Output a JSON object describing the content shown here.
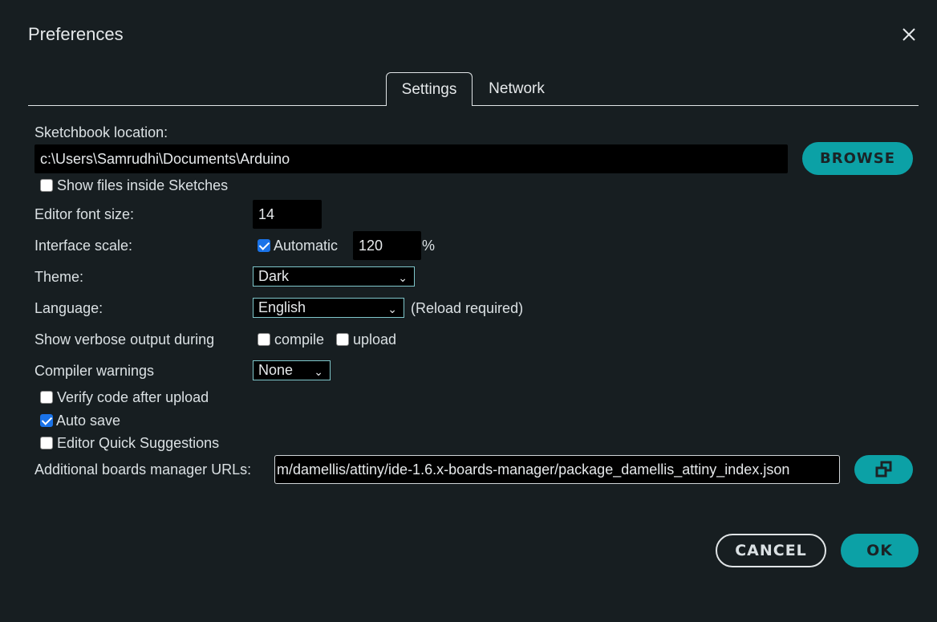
{
  "dialog": {
    "title": "Preferences"
  },
  "tabs": [
    {
      "label": "Settings",
      "active": true
    },
    {
      "label": "Network",
      "active": false
    }
  ],
  "settings": {
    "sketchbook_label": "Sketchbook location:",
    "sketchbook_value": "c:\\Users\\Samrudhi\\Documents\\Arduino",
    "browse_label": "BROWSE",
    "show_files_label": "Show files inside Sketches",
    "show_files_checked": false,
    "font_size_label": "Editor font size:",
    "font_size_value": "14",
    "scale_label": "Interface scale:",
    "scale_auto_label": "Automatic",
    "scale_auto_checked": true,
    "scale_value": "120",
    "scale_unit": "%",
    "theme_label": "Theme:",
    "theme_value": "Dark",
    "language_label": "Language:",
    "language_value": "English",
    "language_note": "(Reload required)",
    "verbose_label": "Show verbose output during",
    "compile_label": "compile",
    "compile_checked": false,
    "upload_label": "upload",
    "upload_checked": false,
    "warnings_label": "Compiler warnings",
    "warnings_value": "None",
    "verify_label": "Verify code after upload",
    "verify_checked": false,
    "autosave_label": "Auto save",
    "autosave_checked": true,
    "quick_label": "Editor Quick Suggestions",
    "quick_checked": false,
    "boards_label": "Additional boards manager URLs:",
    "boards_value": "m/damellis/attiny/ide-1.6.x-boards-manager/package_damellis_attiny_index.json"
  },
  "footer": {
    "cancel_label": "CANCEL",
    "ok_label": "OK"
  },
  "colors": {
    "accent": "#0ca1a6",
    "background": "#171e21"
  }
}
